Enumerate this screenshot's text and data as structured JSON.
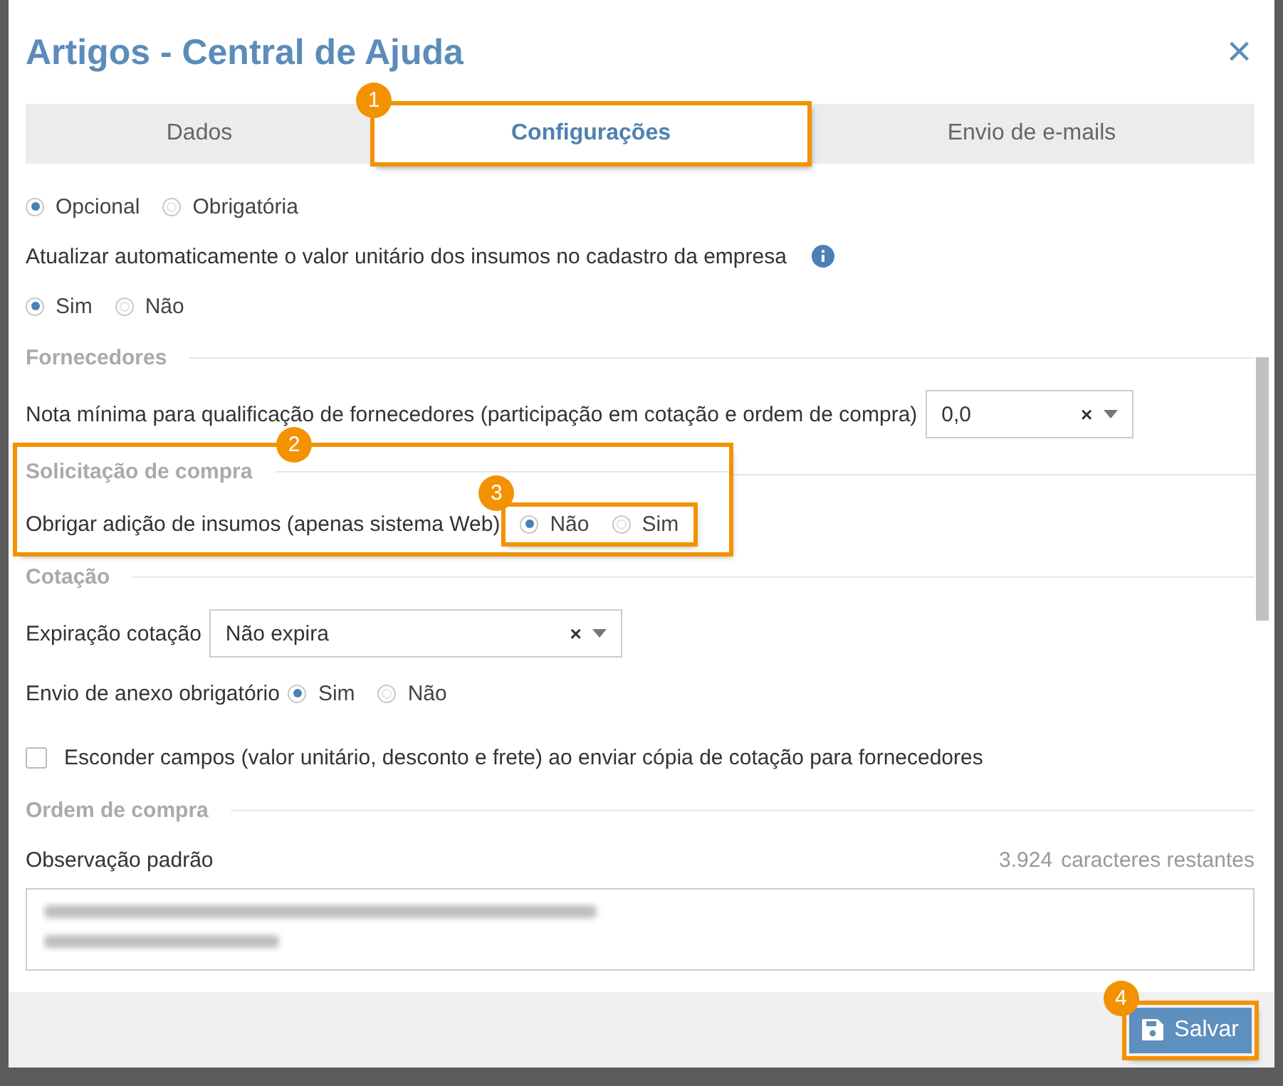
{
  "dialog": {
    "title": "Artigos - Central de Ajuda",
    "close": "×"
  },
  "tabs": [
    {
      "label": "Dados",
      "selected": false
    },
    {
      "label": "Configurações",
      "selected": true,
      "annotation": "1"
    },
    {
      "label": "Envio de e-mails",
      "selected": false
    }
  ],
  "rows": [
    {
      "kind": "radio",
      "options": [
        {
          "label": "Opcional",
          "selected": true
        },
        {
          "label": "Obrigatória",
          "selected": false
        }
      ]
    },
    {
      "kind": "info",
      "label": "Atualizar automaticamente o valor unitário dos insumos no cadastro da empresa"
    },
    {
      "kind": "radio",
      "options": [
        {
          "label": "Sim",
          "selected": true
        },
        {
          "label": "Não",
          "selected": false
        }
      ]
    },
    {
      "kind": "header",
      "label": "Fornecedores"
    },
    {
      "kind": "select",
      "label": "Nota mínima para qualificação de fornecedores (participação em cotação e ordem de compra)",
      "value": "0,0",
      "clear": "×"
    },
    {
      "kind": "section",
      "annotation": "2",
      "header": "Solicitação de compra",
      "label": "Obrigar adição de insumos (apenas sistema Web)",
      "options_annotation": "3",
      "options": [
        {
          "label": "Não",
          "selected": true
        },
        {
          "label": "Sim",
          "selected": false
        }
      ]
    },
    {
      "kind": "header",
      "label": "Cotação"
    },
    {
      "kind": "select",
      "label": "Expiração cotação",
      "value": "Não expira",
      "clear": "×"
    },
    {
      "kind": "radio",
      "label": "Envio de anexo obrigatório",
      "options": [
        {
          "label": "Sim",
          "selected": true
        },
        {
          "label": "Não",
          "selected": false
        }
      ]
    },
    {
      "kind": "checkbox",
      "label": "Esconder campos (valor unitário, desconto e frete) ao enviar cópia de cotação para fornecedores",
      "checked": false
    },
    {
      "kind": "header",
      "label": "Ordem de compra"
    },
    {
      "kind": "textarea",
      "label": "Observação padrão",
      "counter": "3.924",
      "counter_label": "caracteres restantes"
    }
  ],
  "footer": {
    "save": "Salvar",
    "annotation": "4"
  }
}
